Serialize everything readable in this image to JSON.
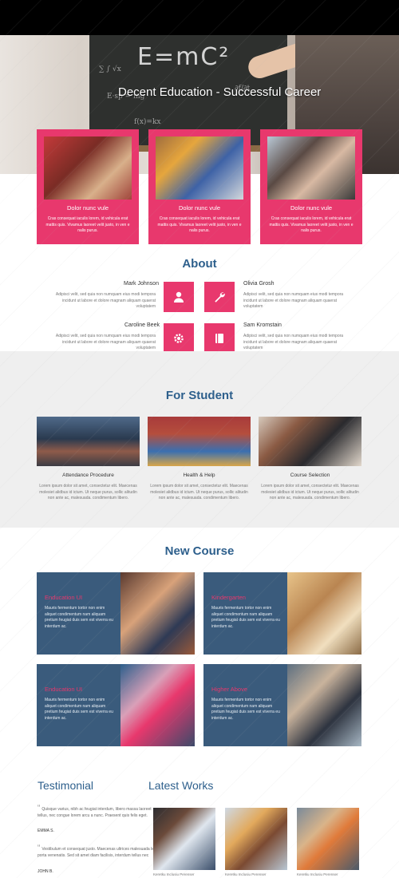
{
  "hero": {
    "headline": "Decent Education - Successful Career",
    "board_equation": "E=mC²"
  },
  "cards": [
    {
      "title": "Dolor nunc vule",
      "text": "Cras consequat iaculis lorem, id vehicula erat mattis quis. Vivamus laoreet velit justo, in ven e nalis purus."
    },
    {
      "title": "Dolor nunc vule",
      "text": "Cras consequat iaculis lorem, id vehicula erat mattis quis. Vivamus laoreet velit justo, in ven e nalis purus."
    },
    {
      "title": "Dolor nunc vule",
      "text": "Cras consequat iaculis lorem, id vehicula erat mattis quis. Vivamus laoreet velit justo, in ven e nalis purus."
    }
  ],
  "about": {
    "title": "About",
    "people": [
      {
        "name": "Mark Johnson",
        "text": "Adipisci velit, sed quia non numquam eius modi tempora incidunt ut labore et dolore magnam aliquam quaerat voluptatem"
      },
      {
        "name": "Olivia Grosh",
        "text": "Adipisci velit, sed quia non numquam eius modi tempora incidunt ut labore et dolore magnam aliquam quaerat voluptatem"
      },
      {
        "name": "Caroline Beek",
        "text": "Adipisci velit, sed quia non numquam eius modi tempora incidunt ut labore et dolore magnam aliquam quaerat voluptatem"
      },
      {
        "name": "Sam Kromstain",
        "text": "Adipisci velit, sed quia non numquam eius modi tempora incidunt ut labore et dolore magnam aliquam quaerat voluptatem"
      }
    ],
    "tiles": [
      {
        "icon": "user-icon"
      },
      {
        "icon": "wrench-icon"
      },
      {
        "icon": "gear-icon"
      },
      {
        "icon": "book-icon"
      }
    ]
  },
  "student": {
    "title": "For Student",
    "items": [
      {
        "title": "Attendance Procedure",
        "text": "Lorem ipsum dolor sit amet, consectetur elit. Maecenas molesiet alidbus id ictum. Ut neque purus, sollic alitudin non ante ac, malesuada. condimentum libero."
      },
      {
        "title": "Health & Help",
        "text": "Lorem ipsum dolor sit amet, consectetur elit. Maecenas molesiet alidbus id ictum. Ut neque purus, sollic alitudin non ante ac, malesuada. condimentum libero."
      },
      {
        "title": "Course Selection",
        "text": "Lorem ipsum dolor sit amet, consectetur elit. Maecenas molesiet alidbus id ictum. Ut neque purus, sollic alitudin non ante ac, malesuada. condimentum libero."
      }
    ]
  },
  "course": {
    "title": "New Course",
    "items": [
      {
        "title": "Enducation UI",
        "text": "Mauris fermentum tortor non enim aliquet condimentum nam aliquam pretium feugiat duis sem est viverra eu interdum ac."
      },
      {
        "title": "Kindergarten",
        "text": "Mauris fermentum tortor non enim aliquet condimentum nam aliquam pretium feugiat duis sem est viverra eu interdum ac."
      },
      {
        "title": "Enducation UI",
        "text": "Mauris fermentum tortor non enim aliquet condimentum nam aliquam pretium feugiat duis sem est viverra eu interdum ac."
      },
      {
        "title": "Higher Above",
        "text": "Mauris fermentum tortor non enim aliquet condimentum nam aliquam pretium feugiat duis sem est viverra eu interdum ac."
      }
    ]
  },
  "testimonial": {
    "title": "Testimonial",
    "quotes": [
      {
        "text": "Quisque varius, nibh ac feugiat interdum, libero massa laoreet tellus, nec congue lorem arcu a nunc. Praesent quis felis eget.",
        "author": "EMMA S."
      },
      {
        "text": "Vestibulum et consequat justo. Maecenas ultrices malesuada leo porta venenatis. Sed sit amet diam facilisis, interdum tellus nec",
        "author": "JOHN B."
      }
    ]
  },
  "works": {
    "title": "Latest Works",
    "items": [
      {
        "caption": "Keretku Inclusiu Perenser"
      },
      {
        "caption": "Keretku Inclusiu Perenser"
      },
      {
        "caption": "Keretku Inclusiu Perenser"
      }
    ]
  }
}
